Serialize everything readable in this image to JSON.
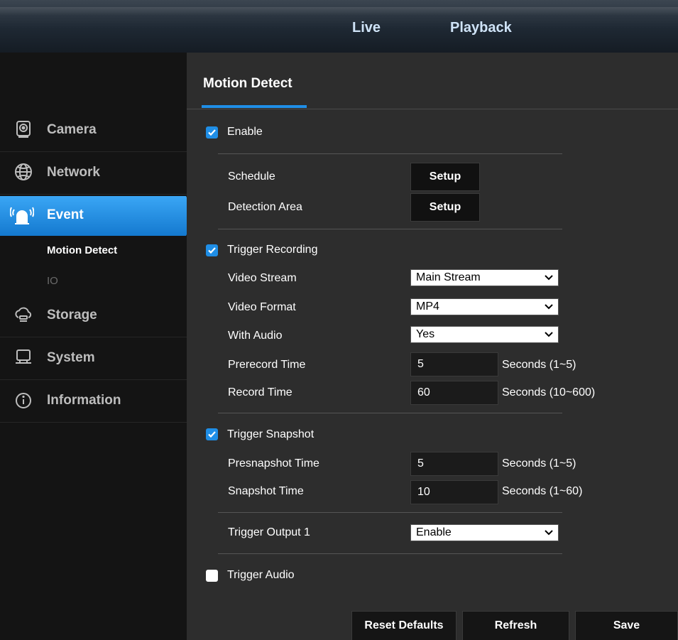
{
  "topnav": {
    "live": "Live",
    "playback": "Playback"
  },
  "sidebar": {
    "camera": "Camera",
    "network": "Network",
    "event": "Event",
    "event_sub": {
      "motion_detect": "Motion Detect",
      "io": "IO"
    },
    "storage": "Storage",
    "system": "System",
    "information": "Information",
    "active": "Event",
    "active_color": "#1f8ee6"
  },
  "page": {
    "title": "Motion Detect",
    "enable": {
      "label": "Enable",
      "checked": true
    },
    "schedule": {
      "label": "Schedule",
      "button": "Setup"
    },
    "detection_area": {
      "label": "Detection Area",
      "button": "Setup"
    },
    "trigger_recording": {
      "label": "Trigger Recording",
      "checked": true
    },
    "video_stream": {
      "label": "Video Stream",
      "value": "Main Stream"
    },
    "video_format": {
      "label": "Video Format",
      "value": "MP4"
    },
    "with_audio": {
      "label": "With Audio",
      "value": "Yes"
    },
    "prerecord_time": {
      "label": "Prerecord Time",
      "value": "5",
      "unit": "Seconds (1~5)"
    },
    "record_time": {
      "label": "Record Time",
      "value": "60",
      "unit": "Seconds (10~600)"
    },
    "trigger_snapshot": {
      "label": "Trigger Snapshot",
      "checked": true
    },
    "presnapshot_time": {
      "label": "Presnapshot Time",
      "value": "5",
      "unit": "Seconds (1~5)"
    },
    "snapshot_time": {
      "label": "Snapshot Time",
      "value": "10",
      "unit": "Seconds (1~60)"
    },
    "trigger_output_1": {
      "label": "Trigger Output 1",
      "value": "Enable"
    },
    "trigger_audio": {
      "label": "Trigger Audio",
      "checked": false
    }
  },
  "actions": {
    "reset_defaults": "Reset Defaults",
    "refresh": "Refresh",
    "save": "Save"
  },
  "colors": {
    "accent": "#1f8ee6",
    "panel": "#2d2d2d",
    "sidebar": "#141414"
  }
}
